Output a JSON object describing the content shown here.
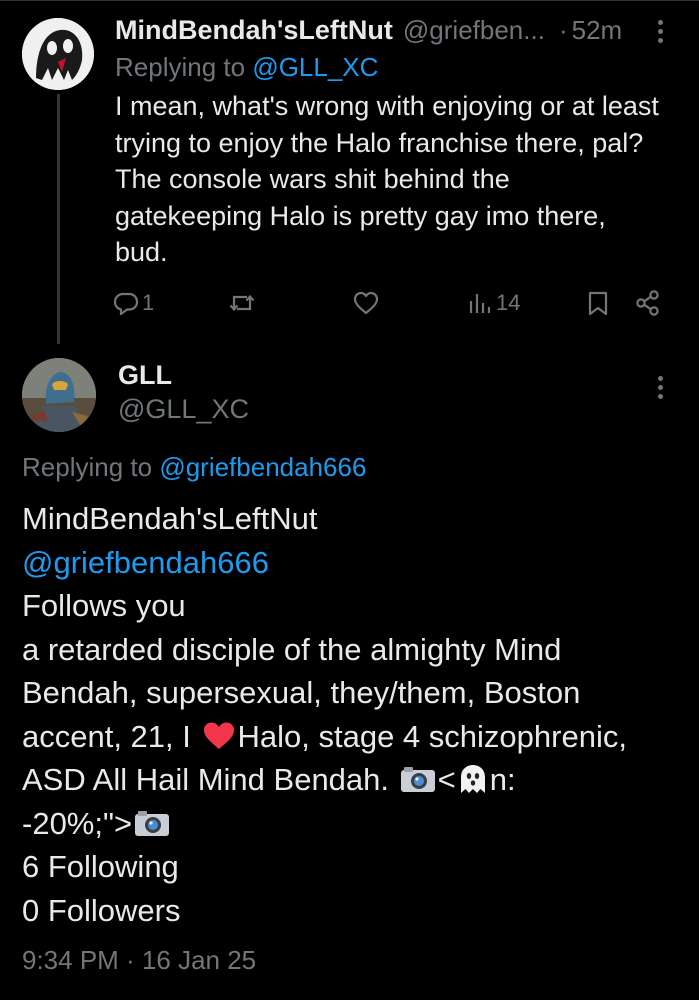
{
  "reply": {
    "author_name": "MindBendah'sLeftNut",
    "author_handle": "@griefben...",
    "separator": "·",
    "time": "52m",
    "replying_prefix": "Replying to ",
    "replying_handle": "@GLL_XC",
    "text_lines": [
      "I mean, what's wrong with enjoying or at least",
      "trying to enjoy the Halo franchise there, pal?",
      "The console wars shit behind the",
      "gatekeeping Halo is pretty gay imo there,",
      "bud."
    ],
    "actions": {
      "reply_icon": "reply-icon",
      "reply_count": "1",
      "repost_icon": "repost-icon",
      "like_icon": "heart-icon",
      "views_icon": "views-chart-icon",
      "views_count": "14",
      "bookmark_icon": "bookmark-icon",
      "share_icon": "share-icon"
    }
  },
  "main": {
    "author_name": "GLL",
    "author_handle": "@GLL_XC",
    "replying_prefix": "Replying to ",
    "replying_handle": "@griefbendah666",
    "text": {
      "line1": "MindBendah'sLeftNut",
      "line2_handle": "@griefbendah666",
      "line3": "Follows you",
      "line4": "a retarded disciple of the almighty Mind",
      "line5": "Bendah, supersexual, they/them, Boston",
      "line6_a": "accent, 21, I ",
      "line6_b": "Halo, stage 4 schizophrenic,",
      "line7_a": "ASD All Hail Mind Bendah. ",
      "line7_b": "<",
      "line7_c": "n:",
      "line8_a": "-20%;\">",
      "line9": "6 Following",
      "line10": "0 Followers"
    },
    "emoji": {
      "heart": "heart-emoji",
      "camera": "camera-emoji",
      "ghost": "ghost-emoji"
    },
    "timestamp": "9:34 PM · 16 Jan 25"
  },
  "colors": {
    "background": "#000000",
    "text": "#e7e9ea",
    "secondary": "#71767b",
    "link": "#1d9bf0"
  }
}
